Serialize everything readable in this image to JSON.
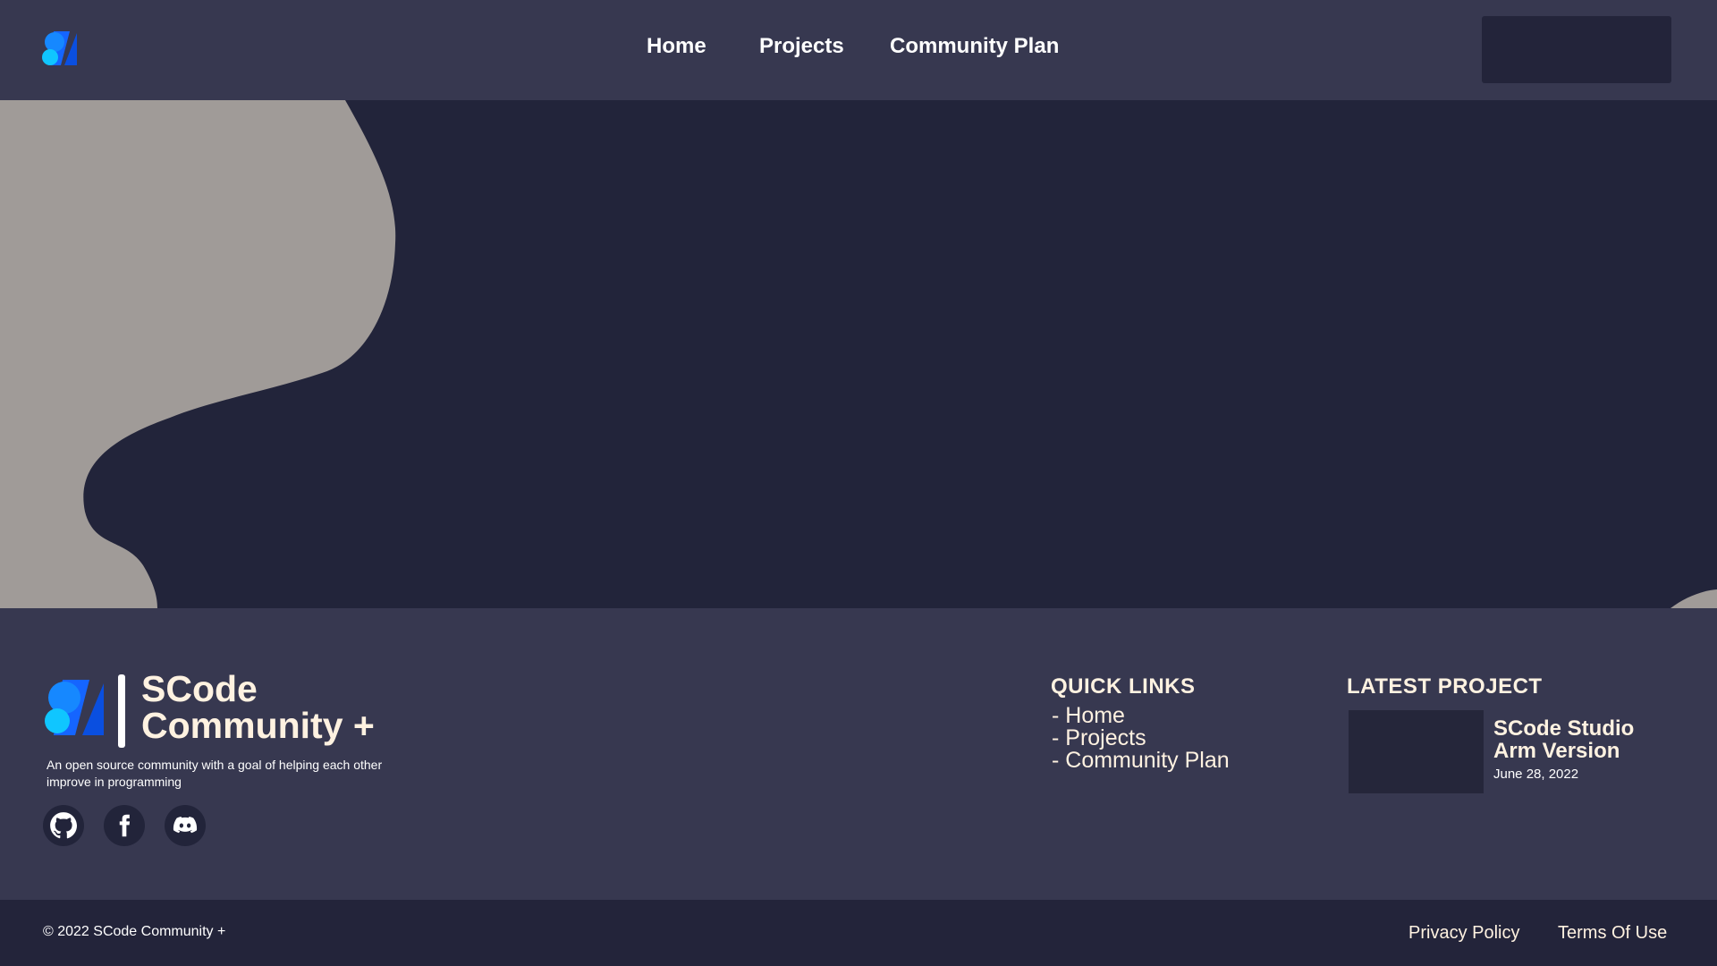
{
  "nav": {
    "logo_icon": "scode-logo-icon",
    "links": [
      {
        "label": "Home"
      },
      {
        "label": "Projects"
      },
      {
        "label": "Community Plan"
      }
    ]
  },
  "colors": {
    "navbar_bg": "#373850",
    "hero_bg": "#22243a",
    "blob": "#a09b98",
    "accent_blue": "#1565ff",
    "accent_cyan": "#10c6ff",
    "cream_text": "#fff2e1"
  },
  "footer": {
    "brand": {
      "name_line1": "SCode",
      "name_line2": "Community +",
      "description": "An open source community with a goal of helping each other improve in programming"
    },
    "socials": [
      {
        "icon": "github-icon"
      },
      {
        "icon": "facebook-icon"
      },
      {
        "icon": "discord-icon"
      }
    ],
    "quick_links": {
      "title": "QUICK LINKS",
      "items": [
        "- Home",
        "- Projects",
        "- Community Plan"
      ]
    },
    "latest_project": {
      "title": "LATEST PROJECT",
      "name_line1": "SCode Studio",
      "name_line2": "Arm Version",
      "date": "June 28, 2022"
    }
  },
  "bottom_bar": {
    "copyright": "© 2022 SCode Community +",
    "privacy": "Privacy Policy",
    "terms": "Terms Of Use"
  }
}
